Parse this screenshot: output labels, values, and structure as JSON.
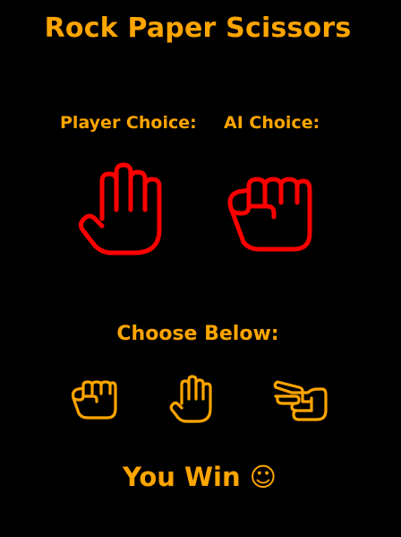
{
  "game": {
    "title": "Rock Paper Scissors",
    "player_label": "Player Choice:",
    "ai_label": "AI Choice:",
    "player_choice": "paper",
    "ai_choice": "rock",
    "choose_label": "Choose Below:",
    "result_text": "You Win ☺"
  },
  "buttons": {
    "rock": "rock-icon",
    "paper": "paper-icon",
    "scissors": "scissors-icon"
  },
  "colors": {
    "background": "#000000",
    "accent": "#ffa500",
    "choice_icon": "#ff0000"
  }
}
